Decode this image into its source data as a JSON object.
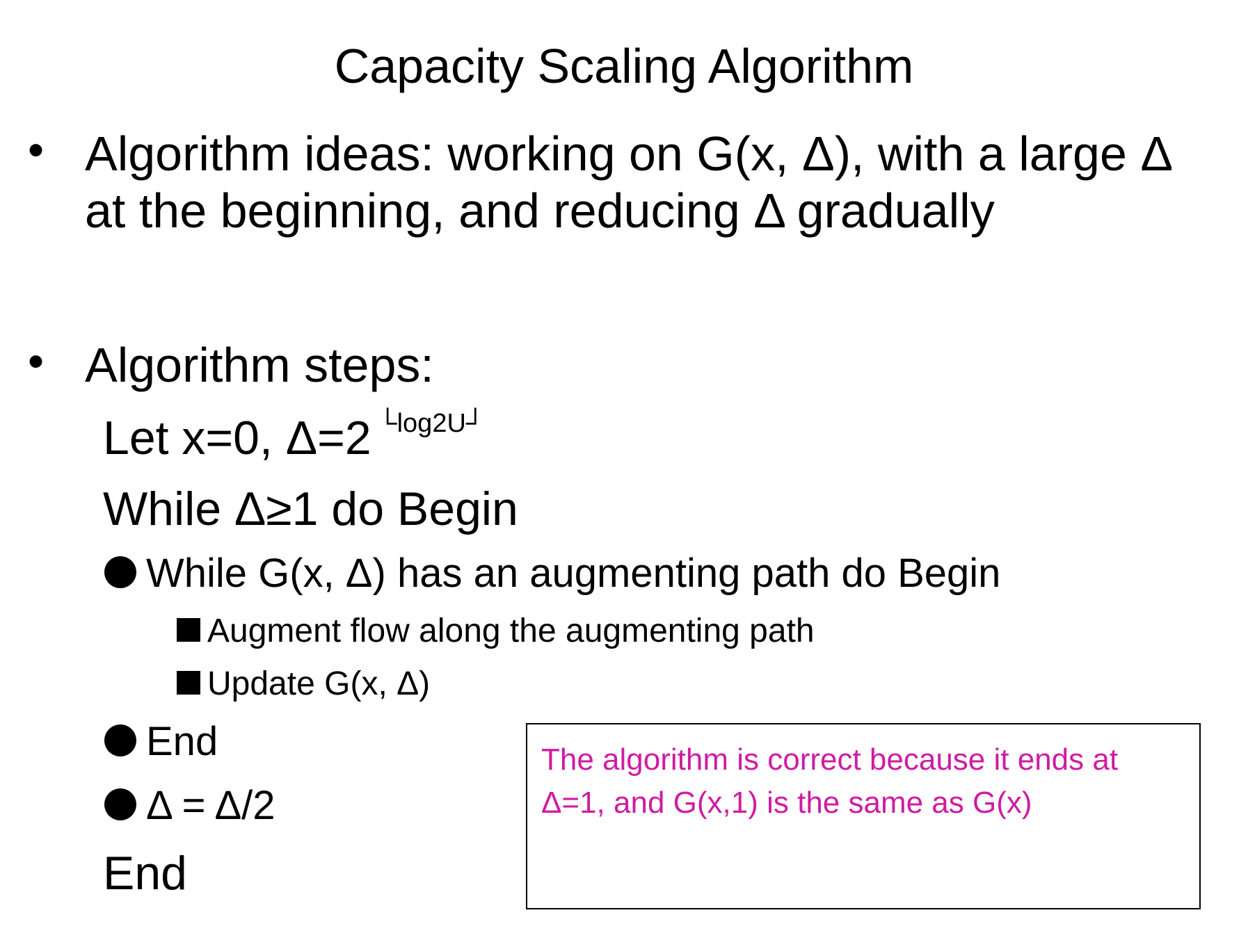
{
  "title": "Capacity Scaling Algorithm",
  "bullets": [
    {
      "marker": "•",
      "lines": [
        "Algorithm ideas: working on G(x, Δ), with a large Δ",
        "at the beginning, and reducing Δ gradually"
      ]
    },
    {
      "marker": "•",
      "lines": [
        "Algorithm steps:"
      ]
    }
  ],
  "steps": {
    "init_text": "Let x=0, Δ=2",
    "init_superscript": "└log2U┘",
    "while_outer": "While Δ≥1 do Begin",
    "while_inner": "While G(x, Δ) has an augmenting path do Begin",
    "augment": "Augment flow along the augmenting path",
    "update": "Update G(x, Δ)",
    "end_inner": "End",
    "halve": "Δ = Δ/2",
    "end_outer": "End"
  },
  "note": {
    "text": "The algorithm is correct because it ends at Δ=1, and G(x,1) is the same as G(x)",
    "color": "#d01ba2"
  }
}
